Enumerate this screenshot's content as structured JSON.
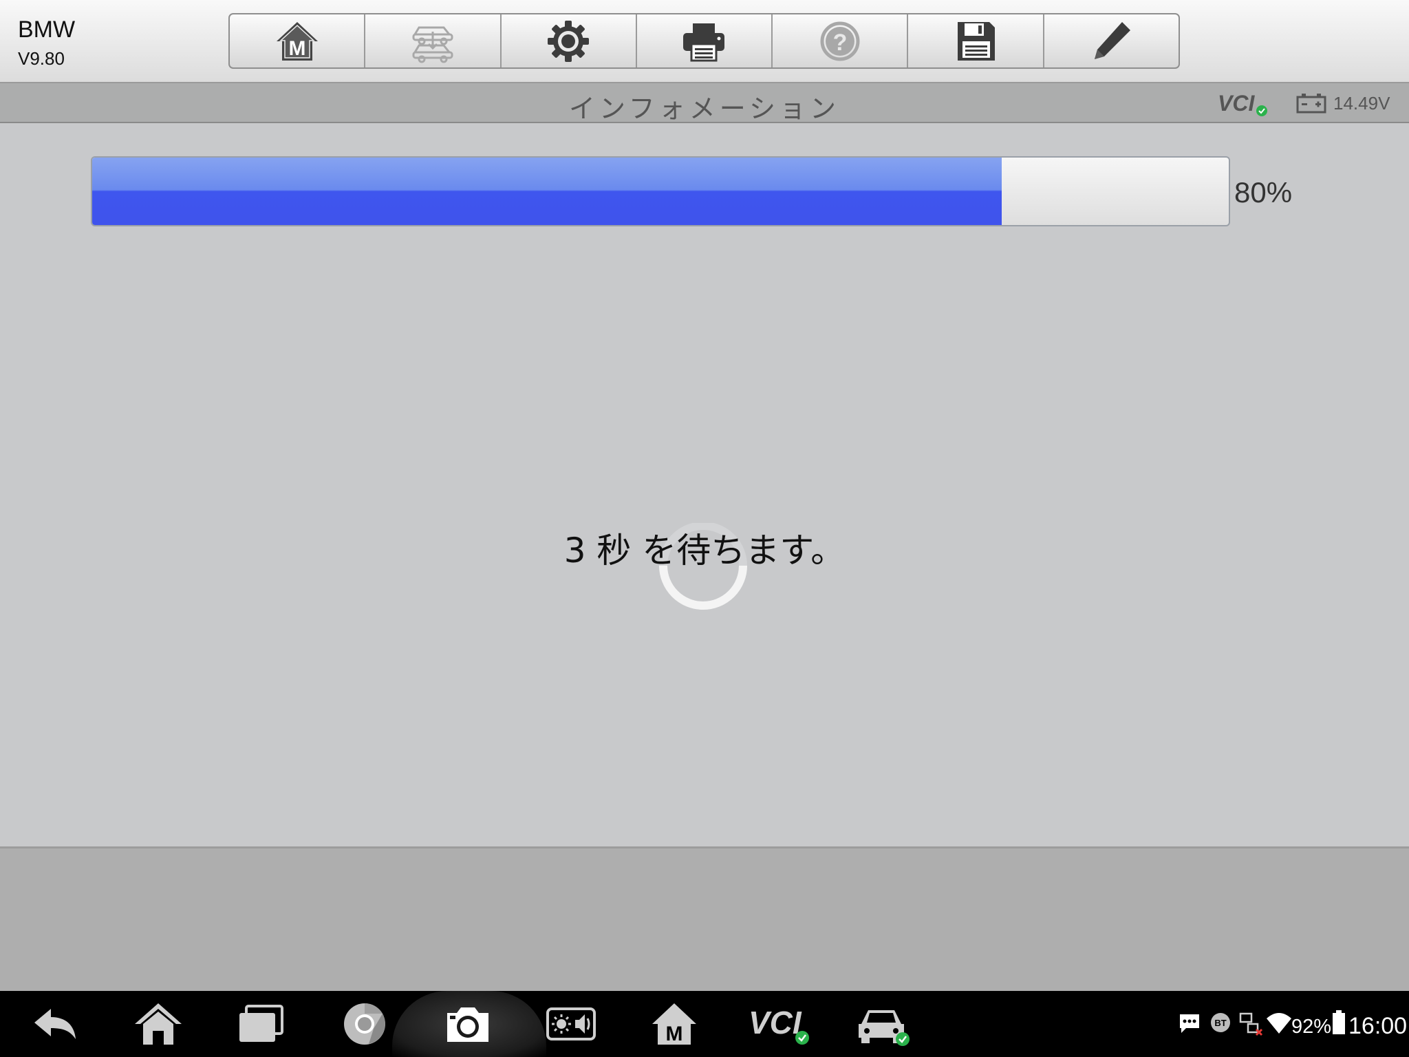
{
  "header": {
    "app_title": "BMW",
    "app_version": "V9.80",
    "toolbar": [
      {
        "name": "home-m-icon"
      },
      {
        "name": "vehicle-swap-icon",
        "disabled": true
      },
      {
        "name": "gear-icon"
      },
      {
        "name": "printer-icon"
      },
      {
        "name": "help-icon",
        "disabled": true
      },
      {
        "name": "save-icon"
      },
      {
        "name": "pencil-icon"
      }
    ]
  },
  "titlebar": {
    "title": "インフォメーション",
    "vcl_label": "VCI",
    "voltage": "14.49V"
  },
  "progress": {
    "percent": 80,
    "label": "80%"
  },
  "message": "3 秒 を待ちます。",
  "navbar": {
    "icons": [
      "back-icon",
      "home-icon",
      "recent-apps-icon",
      "chrome-icon",
      "camera-icon",
      "brightness-volume-icon",
      "maxisys-home-icon",
      "vci-icon",
      "car-connect-icon"
    ],
    "vci_label": "VCI",
    "bt_label": "BT",
    "battery_percent": "92%",
    "clock": "16:00"
  },
  "colors": {
    "progress_fill": "#3f53ec",
    "progress_highlight": "#86a3f0",
    "check_green": "#2bb24c"
  }
}
